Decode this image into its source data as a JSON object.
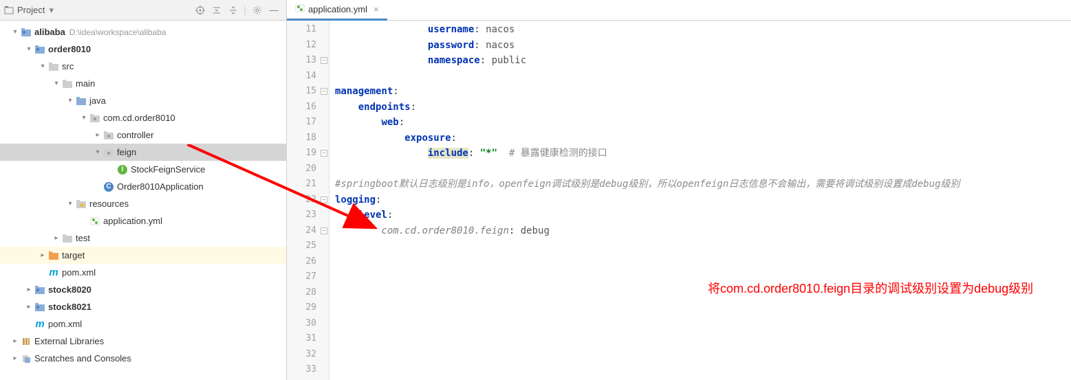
{
  "header": {
    "project_label": "Project"
  },
  "tabs": {
    "file": "application.yml"
  },
  "tree": {
    "root": "alibaba",
    "root_path": "D:\\idea\\workspace\\alibaba",
    "order8010": "order8010",
    "src": "src",
    "main": "main",
    "java": "java",
    "pkg": "com.cd.order8010",
    "controller": "controller",
    "feign": "feign",
    "stockFeignService": "StockFeignService",
    "orderApp": "Order8010Application",
    "resources": "resources",
    "app_yml": "application.yml",
    "test": "test",
    "target": "target",
    "pom1": "pom.xml",
    "stock8020": "stock8020",
    "stock8021": "stock8021",
    "pom2": "pom.xml",
    "ext_lib": "External Libraries",
    "scratches": "Scratches and Consoles"
  },
  "gutter": {
    "lines": [
      "11",
      "12",
      "13",
      "14",
      "15",
      "16",
      "17",
      "18",
      "19",
      "20",
      "21",
      "22",
      "23",
      "24",
      "25",
      "26",
      "27",
      "28",
      "29",
      "30",
      "31",
      "32",
      "33"
    ]
  },
  "code": {
    "l11_k": "username",
    "l11_v": "nacos",
    "l12_k": "password",
    "l12_v": "nacos",
    "l13_k": "namespace",
    "l13_v": "public",
    "l15": "management",
    "l16": "endpoints",
    "l17": "web",
    "l18": "exposure",
    "l19_k": "include",
    "l19_v": "\"*\"",
    "l19_c": "# 暴露健康检测的接口",
    "l21_c": "#springboot默认日志级别是info，openfeign调试级别是debug级别，所以openfeign日志信息不会输出，需要将调试级别设置成debug级别",
    "l22": "logging",
    "l23": "level",
    "l24_k": "com.cd.order8010.feign",
    "l24_v": "debug"
  },
  "annotation": "将com.cd.order8010.feign目录的调试级别设置为debug级别"
}
